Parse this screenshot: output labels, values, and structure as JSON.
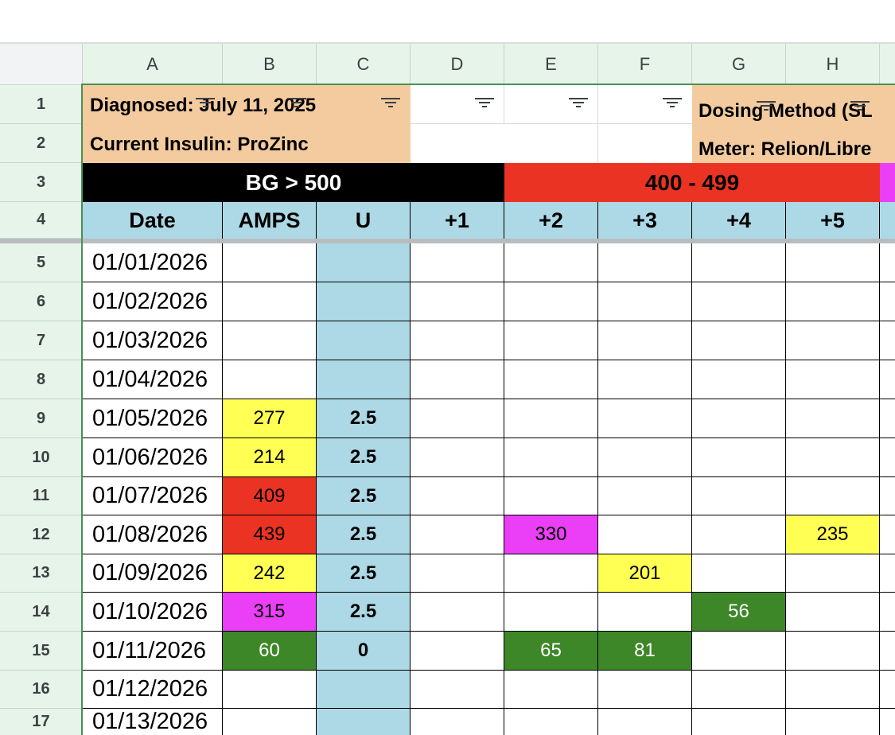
{
  "columns": [
    "A",
    "B",
    "C",
    "D",
    "E",
    "F",
    "G",
    "H"
  ],
  "row_numbers": [
    "1",
    "2",
    "3",
    "4",
    "5",
    "6",
    "7",
    "8",
    "9",
    "10",
    "11",
    "12",
    "13",
    "14",
    "15",
    "16",
    "17"
  ],
  "row1": {
    "diagnosed": "Diagnosed: July 11, 2025",
    "dosing": "Dosing Method (SL"
  },
  "row2": {
    "insulin": "Current Insulin:  ProZinc",
    "meter": "Meter:  Relion/Libre"
  },
  "row3": {
    "black_band": "BG > 500",
    "red_band": "400 - 499"
  },
  "headers": [
    "Date",
    "AMPS",
    "U",
    "+1",
    "+2",
    "+3",
    "+4",
    "+5"
  ],
  "dates": [
    "01/01/2026",
    "01/02/2026",
    "01/03/2026",
    "01/04/2026",
    "01/05/2026",
    "01/06/2026",
    "01/07/2026",
    "01/08/2026",
    "01/09/2026",
    "01/10/2026",
    "01/11/2026",
    "01/12/2026",
    "01/13/2026"
  ],
  "amps": [
    "",
    "",
    "",
    "",
    "277",
    "214",
    "409",
    "439",
    "242",
    "315",
    "60",
    "",
    ""
  ],
  "units": [
    "",
    "",
    "",
    "",
    "2.5",
    "2.5",
    "2.5",
    "2.5",
    "2.5",
    "2.5",
    "0",
    "",
    ""
  ],
  "readings": {
    "row12_e": "330",
    "row12_h": "235",
    "row13_f": "201",
    "row14_g": "56",
    "row15_e": "65",
    "row15_f": "81"
  },
  "colors": {
    "yellow": "#ffff54",
    "red": "#eb3323",
    "magenta": "#ea3ff6",
    "green": "#3e8728",
    "blue": "#add8e6",
    "peach": "#f3cb9f"
  }
}
